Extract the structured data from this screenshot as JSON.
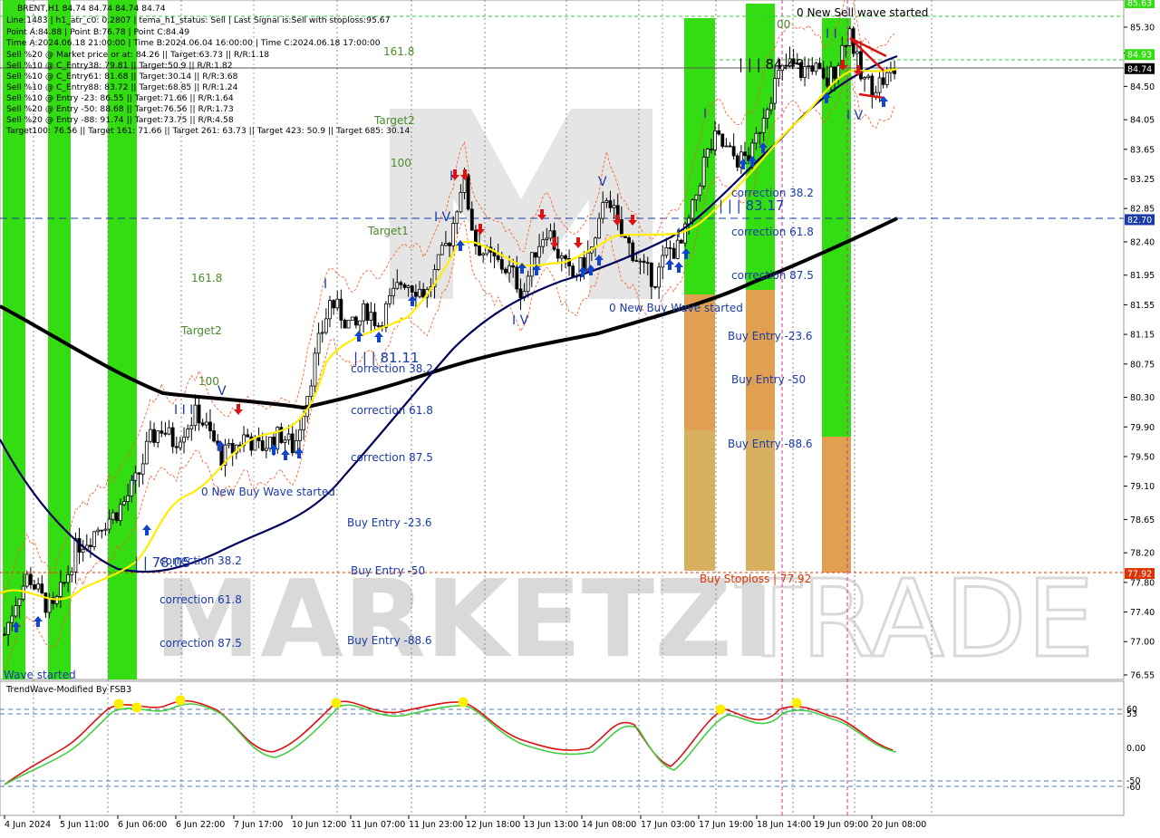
{
  "window": {
    "symbol_line": "BRENT,H1  84.74 84.74 84.74 84.74"
  },
  "info_lines": [
    "Line:1483 | h1_atr_c0: 0.2807 | tema_h1_status: Sell | Last Signal is:Sell with stoploss:95.67",
    "Point A:84.88 | Point B:76.78 | Point C:84.49",
    "Time A:2024.06.18 21:00:00 | Time B:2024.06.04 16:00:00 | Time C:2024.06.18 17:00:00",
    "Sell %20 @ Market price or at: 84.26 || Target:63.73 || R/R:1.18",
    "Sell %10 @ C_Entry38: 79.81 || Target:50.9 || R/R:1.82",
    "Sell %10 @ C_Entry61: 81.68 || Target:30.14 || R/R:3.68",
    "Sell %10 @ C_Entry88: 83.72 || Target:68.85 || R/R:1.24",
    "Sell %10 @ Entry -23: 86.55 || Target:71.66 || R/R:1.64",
    "Sell %20 @ Entry -50: 88.68 || Target:76.56 || R/R:1.73",
    "Sell %20 @ Entry -88: 91.74 || Target:73.75 || R/R:4.58",
    "Target100: 76.56 || Target 161: 71.66 || Target 261: 63.73 || Target 423: 50.9 || Target 685: 30.14"
  ],
  "colors": {
    "green_zone": "#33dd11",
    "orange_zone": "#e0a050",
    "ma_black": "#000000",
    "ma_navy": "#00005a",
    "tema_yellow": "#ffee00",
    "envelope": "#ff4400",
    "buy_arrow": "#1144cc",
    "sell_arrow": "#dd1111",
    "label_green": "#4a8a2a",
    "label_blue": "#1a3aa8",
    "stoploss_red": "#dd3300",
    "osc_red": "#dd1111",
    "osc_green": "#44cc44",
    "dot_yellow": "#ffee00"
  },
  "price_axis": {
    "ticks": [
      "85.30",
      "84.95",
      "84.50",
      "84.05",
      "83.65",
      "83.25",
      "82.85",
      "82.40",
      "81.95",
      "81.55",
      "81.15",
      "80.75",
      "80.30",
      "79.90",
      "79.50",
      "79.10",
      "78.65",
      "78.20",
      "77.80",
      "77.40",
      "77.00",
      "76.55"
    ],
    "badges": [
      {
        "text": "85.63",
        "color": "#33dd11",
        "price": 85.63
      },
      {
        "text": "84.93",
        "color": "#33dd11",
        "price": 84.93
      },
      {
        "text": "84.74",
        "color": "#000000",
        "price": 84.74
      },
      {
        "text": "82.70",
        "color": "#1a3aa8",
        "price": 82.7
      },
      {
        "text": "77.92",
        "color": "#dd3300",
        "price": 77.92
      }
    ]
  },
  "time_axis": [
    "4 Jun 2024",
    "5 Jun 11:00",
    "6 Jun 06:00",
    "6 Jun 22:00",
    "7 Jun 17:00",
    "10 Jun 12:00",
    "11 Jun 07:00",
    "11 Jun 23:00",
    "12 Jun 18:00",
    "13 Jun 13:00",
    "14 Jun 08:00",
    "17 Jun 03:00",
    "17 Jun 19:00",
    "18 Jun 14:00",
    "19 Jun 09:00",
    "20 Jun 08:00"
  ],
  "labels": {
    "new_sell_wave": "0 New Sell wave started",
    "new_buy_wave_mid": "0 New Buy Wave started",
    "new_buy_wave_left": "0 New Buy Wave started",
    "wave_started": "Wave started",
    "buy_stoploss": "Buy Stoploss | 77.92",
    "price_81_11": "| | | 81.11",
    "price_83_17": "| | | 83.17",
    "price_84_49": "| | | 84.49",
    "price_78_05": "| | 78.05",
    "fib_161_a": "161.8",
    "fib_100_a": "100",
    "target2_a": "Target2",
    "target1_a": "Target1",
    "fib_161_b": "161.8",
    "target2_b": "Target2",
    "fib_100_b": "100",
    "fib_00": "00",
    "corr_382_a": "correction 38.2",
    "corr_618_a": "correction 61.8",
    "corr_875_a": "correction 87.5",
    "buy_236_a": "Buy Entry -23.6",
    "buy_50_a": "Buy Entry -50",
    "buy_886_a": "Buy Entry -88.6",
    "corr_382_b": "correction 38.2",
    "corr_618_b": "correction 61.8",
    "corr_875_b": "correction 87.5",
    "buy_236_b": "Buy Entry -23.6",
    "buy_50_b": "Buy Entry -50",
    "buy_886_b": "Buy Entry -88.6",
    "corr_382_c": "correction 38.2",
    "corr_618_c": "correction 61.8",
    "corr_875_c": "correction 87.5",
    "wave_I_1": "I",
    "wave_III_1": "I I I",
    "wave_V_1": "V",
    "wave_I_2": "I",
    "wave_IV_2": "I V",
    "wave_V_2": "V",
    "wave_I_3": "I",
    "wave_III_3": "I I I",
    "wave_IV_3": "I V",
    "wave_I_4": "I",
    "wave_IV_4": "I V",
    "wave_II_5": "I I",
    "wave_I_5": "I",
    "watermark_a": "MARKETZI",
    "watermark_b": "TRADE"
  },
  "oscillator": {
    "title": "TrendWave-Modified By FSB3",
    "ticks": [
      "60",
      "53",
      "0.00",
      "-50",
      "-60"
    ]
  },
  "chart_data": {
    "type": "candlestick",
    "title": "BRENT,H1",
    "ylim": [
      76.4,
      85.6
    ],
    "last_price": 84.74,
    "levels": {
      "target_line": 82.7,
      "buy_stoploss": 77.92,
      "upper_dotted": 85.63,
      "upper_dotted_2": 84.93
    },
    "close_path": [
      {
        "t": 0,
        "v": 77.1
      },
      {
        "t": 2,
        "v": 77.6
      },
      {
        "t": 4,
        "v": 77.9
      },
      {
        "t": 6,
        "v": 77.6
      },
      {
        "t": 8,
        "v": 77.4
      },
      {
        "t": 10,
        "v": 77.8
      },
      {
        "t": 12,
        "v": 78.3
      },
      {
        "t": 14,
        "v": 78.4
      },
      {
        "t": 16,
        "v": 78.6
      },
      {
        "t": 18,
        "v": 78.7
      },
      {
        "t": 20,
        "v": 78.9
      },
      {
        "t": 22,
        "v": 79.2
      },
      {
        "t": 24,
        "v": 79.7
      },
      {
        "t": 26,
        "v": 79.9
      },
      {
        "t": 28,
        "v": 79.7
      },
      {
        "t": 30,
        "v": 79.9
      },
      {
        "t": 32,
        "v": 80.1
      },
      {
        "t": 34,
        "v": 79.8
      },
      {
        "t": 36,
        "v": 79.5
      },
      {
        "t": 38,
        "v": 79.6
      },
      {
        "t": 40,
        "v": 79.8
      },
      {
        "t": 42,
        "v": 79.6
      },
      {
        "t": 44,
        "v": 79.7
      },
      {
        "t": 46,
        "v": 79.8
      },
      {
        "t": 48,
        "v": 79.6
      },
      {
        "t": 50,
        "v": 80.3
      },
      {
        "t": 52,
        "v": 81.0
      },
      {
        "t": 54,
        "v": 81.6
      },
      {
        "t": 56,
        "v": 81.4
      },
      {
        "t": 58,
        "v": 81.2
      },
      {
        "t": 60,
        "v": 81.5
      },
      {
        "t": 62,
        "v": 81.3
      },
      {
        "t": 64,
        "v": 81.6
      },
      {
        "t": 66,
        "v": 81.9
      },
      {
        "t": 68,
        "v": 81.8
      },
      {
        "t": 70,
        "v": 81.7
      },
      {
        "t": 72,
        "v": 82.1
      },
      {
        "t": 74,
        "v": 82.5
      },
      {
        "t": 76,
        "v": 83.3
      },
      {
        "t": 78,
        "v": 82.4
      },
      {
        "t": 80,
        "v": 82.2
      },
      {
        "t": 82,
        "v": 82.1
      },
      {
        "t": 84,
        "v": 82.0
      },
      {
        "t": 86,
        "v": 81.7
      },
      {
        "t": 88,
        "v": 82.3
      },
      {
        "t": 90,
        "v": 82.6
      },
      {
        "t": 92,
        "v": 82.2
      },
      {
        "t": 94,
        "v": 81.9
      },
      {
        "t": 96,
        "v": 82.1
      },
      {
        "t": 98,
        "v": 82.4
      },
      {
        "t": 100,
        "v": 83.1
      },
      {
        "t": 102,
        "v": 82.5
      },
      {
        "t": 104,
        "v": 82.3
      },
      {
        "t": 106,
        "v": 82.0
      },
      {
        "t": 108,
        "v": 81.9
      },
      {
        "t": 110,
        "v": 82.3
      },
      {
        "t": 112,
        "v": 82.3
      },
      {
        "t": 114,
        "v": 82.8
      },
      {
        "t": 116,
        "v": 83.5
      },
      {
        "t": 118,
        "v": 83.8
      },
      {
        "t": 120,
        "v": 83.6
      },
      {
        "t": 122,
        "v": 83.5
      },
      {
        "t": 124,
        "v": 83.6
      },
      {
        "t": 126,
        "v": 84.2
      },
      {
        "t": 128,
        "v": 84.6
      },
      {
        "t": 130,
        "v": 84.8
      },
      {
        "t": 132,
        "v": 84.7
      },
      {
        "t": 134,
        "v": 84.8
      },
      {
        "t": 136,
        "v": 84.5
      },
      {
        "t": 138,
        "v": 84.8
      },
      {
        "t": 140,
        "v": 85.3
      },
      {
        "t": 142,
        "v": 84.6
      },
      {
        "t": 144,
        "v": 84.5
      },
      {
        "t": 146,
        "v": 84.6
      },
      {
        "t": 148,
        "v": 84.74
      }
    ]
  }
}
